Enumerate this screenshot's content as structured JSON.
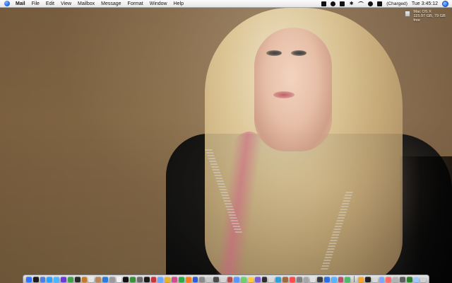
{
  "menubar": {
    "app_name": "Mail",
    "menus": [
      "File",
      "Edit",
      "View",
      "Mailbox",
      "Message",
      "Format",
      "Window",
      "Help"
    ],
    "status": {
      "battery_text": "(Charged)",
      "clock_text": "Tue 3:45:12"
    }
  },
  "desktop_icon": {
    "line1": "Mac OS X",
    "line2": "115.97 GB, 79 GB free"
  },
  "dock": {
    "apps": [
      {
        "name": "finder",
        "color": "#2f74ff"
      },
      {
        "name": "dashboard",
        "color": "#1b1b1b"
      },
      {
        "name": "mail",
        "color": "#4a7fe6"
      },
      {
        "name": "safari",
        "color": "#2ea0ff"
      },
      {
        "name": "ichat",
        "color": "#4bb6ff"
      },
      {
        "name": "itunes",
        "color": "#6b3bd6"
      },
      {
        "name": "iphoto",
        "color": "#3ea04a"
      },
      {
        "name": "imovie",
        "color": "#2a2a2a"
      },
      {
        "name": "garageband",
        "color": "#c07a2b"
      },
      {
        "name": "ical",
        "color": "#e6e6e6"
      },
      {
        "name": "address-book",
        "color": "#b8865b"
      },
      {
        "name": "preview",
        "color": "#2d7bd9"
      },
      {
        "name": "system-preferences",
        "color": "#9a9a9a"
      },
      {
        "name": "textedit",
        "color": "#f1f1f1"
      },
      {
        "name": "terminal",
        "color": "#111111"
      },
      {
        "name": "activity-monitor",
        "color": "#3c8d3c"
      },
      {
        "name": "console",
        "color": "#6b6b6b"
      },
      {
        "name": "quicktime",
        "color": "#1a1a1a"
      },
      {
        "name": "photo-booth",
        "color": "#c7353a"
      },
      {
        "name": "app",
        "color": "#6aa6ff"
      },
      {
        "name": "app",
        "color": "#e8b12b"
      },
      {
        "name": "app",
        "color": "#d04d8a"
      },
      {
        "name": "app",
        "color": "#2ba84a"
      },
      {
        "name": "app",
        "color": "#ff7a1a"
      },
      {
        "name": "app",
        "color": "#2b5dd9"
      },
      {
        "name": "app",
        "color": "#8a8a8a"
      },
      {
        "name": "app",
        "color": "#c8c8c8"
      },
      {
        "name": "app",
        "color": "#4a4a4a"
      },
      {
        "name": "app",
        "color": "#d5d5d5"
      },
      {
        "name": "app",
        "color": "#b44c4c"
      },
      {
        "name": "app",
        "color": "#5a97ff"
      },
      {
        "name": "app",
        "color": "#6fcf70"
      },
      {
        "name": "app",
        "color": "#ffc94a"
      },
      {
        "name": "app",
        "color": "#7b5bd6"
      },
      {
        "name": "app",
        "color": "#2c2c2c"
      },
      {
        "name": "app",
        "color": "#d9d9d9"
      },
      {
        "name": "app",
        "color": "#2f9fd6"
      },
      {
        "name": "app",
        "color": "#9c6b3d"
      },
      {
        "name": "app",
        "color": "#ff4a4a"
      },
      {
        "name": "app",
        "color": "#7f7f7f"
      },
      {
        "name": "app",
        "color": "#a7a7a7"
      },
      {
        "name": "app",
        "color": "#e0e0e0"
      },
      {
        "name": "app",
        "color": "#3a3a3a"
      },
      {
        "name": "app",
        "color": "#2d6ee5"
      },
      {
        "name": "app",
        "color": "#59b4ff"
      },
      {
        "name": "app",
        "color": "#c24a6a"
      },
      {
        "name": "app",
        "color": "#4cba6a"
      },
      {
        "name": "app",
        "color": "#f2a531"
      },
      {
        "name": "app",
        "color": "#1f1f1f"
      },
      {
        "name": "app",
        "color": "#d8d8d8"
      },
      {
        "name": "app",
        "color": "#7aa7ff"
      },
      {
        "name": "app",
        "color": "#ff6b6b"
      },
      {
        "name": "app",
        "color": "#b3b3b3"
      },
      {
        "name": "app",
        "color": "#5d5d5d"
      },
      {
        "name": "app",
        "color": "#2a7f2a"
      },
      {
        "name": "app",
        "color": "#9ecbff"
      }
    ],
    "separator_after_index": 46,
    "trash_color": "#d0d0d0"
  }
}
